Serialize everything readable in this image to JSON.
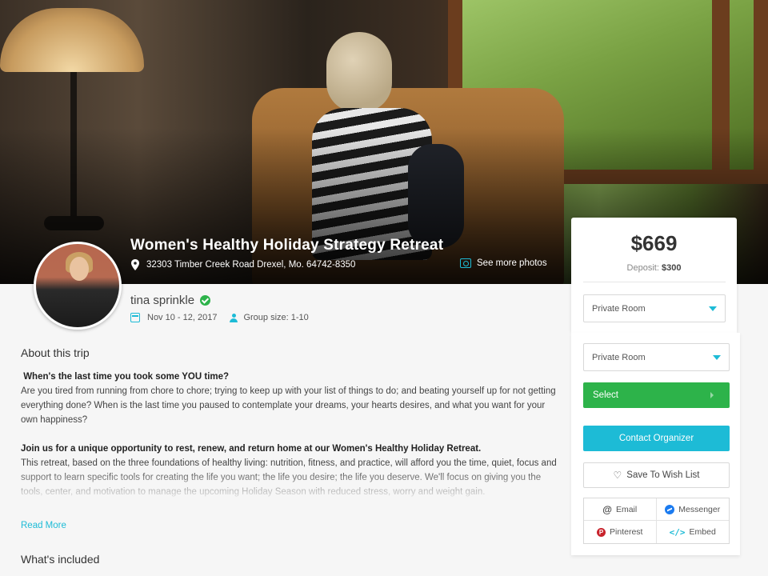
{
  "trip": {
    "title": "Women's Healthy Holiday Strategy Retreat",
    "location": "32303 Timber Creek Road Drexel, Mo. 64742-8350",
    "see_photos": "See more photos",
    "organizer": "tina sprinkle",
    "dates": "Nov 10 - 12, 2017",
    "group_size": "Group size: 1-10"
  },
  "about": {
    "heading": "About this trip",
    "q_heading": "When's the last time you took some YOU time?",
    "q_body": "Are you tired from running from chore to chore; trying to keep up with your list of things to do; and beating yourself up for not getting everything done? When is the last time you paused to contemplate your dreams, your hearts desires, and what you want for your own happiness?",
    "join_heading": "Join us for a unique opportunity to rest, renew, and return home at our Women's Healthy Holiday Retreat.",
    "join_body": "This retreat, based on the three foundations of healthy living: nutrition, fitness, and practice, will afford you the time, quiet, focus and support to learn specific tools for creating the life you want; the life you desire; the life you deserve.  We'll focus on giving you the tools, center, and motivation to manage the upcoming Holiday Season with reduced stress, worry and weight gain.",
    "read_more": "Read More",
    "included_heading": "What's included"
  },
  "booking": {
    "price": "$669",
    "deposit_label": "Deposit:",
    "deposit_value": "$300",
    "room_select_1": "Private Room",
    "room_select_2": "Private Room",
    "select_button": "Select",
    "contact_button": "Contact Organizer",
    "wishlist_button": "Save To Wish List",
    "share": {
      "email": "Email",
      "messenger": "Messenger",
      "pinterest": "Pinterest",
      "embed": "Embed"
    }
  },
  "colors": {
    "accent": "#1dbbd6",
    "green": "#2db34a",
    "messenger": "#1b7bf0",
    "pinterest": "#c8232c"
  },
  "icons": [
    "location-pin-icon",
    "camera-icon",
    "verified-check-icon",
    "calendar-icon",
    "user-icon",
    "chevron-down-icon",
    "arrow-right-icon",
    "heart-icon",
    "at-sign-icon",
    "messenger-icon",
    "pinterest-icon",
    "code-embed-icon"
  ]
}
